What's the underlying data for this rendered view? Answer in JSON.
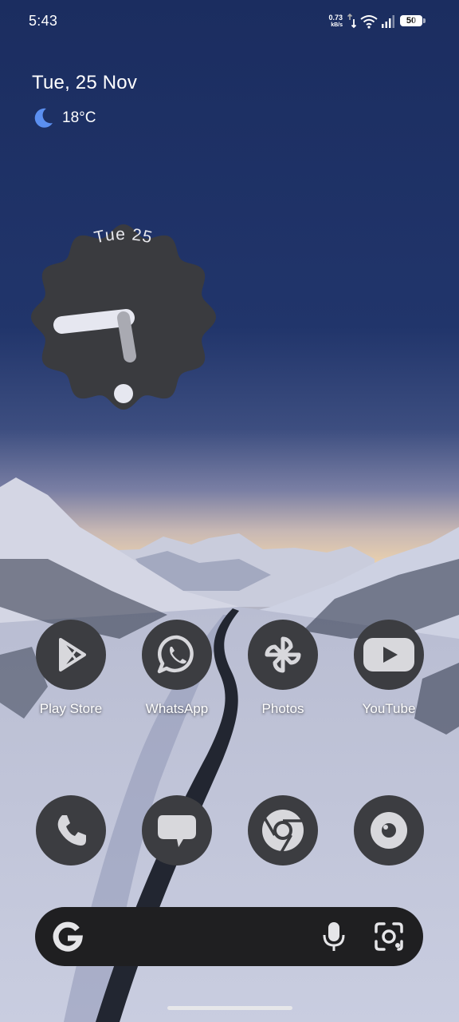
{
  "status_bar": {
    "time": "5:43",
    "net_speed": "0.73",
    "net_speed_unit": "kB/s",
    "battery": "50"
  },
  "at_a_glance": {
    "date": "Tue, 25 Nov",
    "weather_icon": "moon-icon",
    "temperature": "18°C"
  },
  "clock_widget": {
    "date_text": "Tue 25"
  },
  "apps_row_1": [
    {
      "label": "Play Store",
      "icon": "play-store-icon"
    },
    {
      "label": "WhatsApp",
      "icon": "whatsapp-icon"
    },
    {
      "label": "Photos",
      "icon": "photos-icon"
    },
    {
      "label": "YouTube",
      "icon": "youtube-icon"
    }
  ],
  "dock": [
    {
      "icon": "phone-icon"
    },
    {
      "icon": "messages-icon"
    },
    {
      "icon": "chrome-icon"
    },
    {
      "icon": "camera-icon"
    }
  ],
  "search_bar": {
    "logo": "google-g-icon",
    "mic": "mic-icon",
    "lens": "lens-icon"
  },
  "colors": {
    "icon_bg": "#3c3d41",
    "icon_glyph": "#d8d8dc",
    "search_bg": "#1f1f21",
    "sky_top": "#1b2c5e"
  }
}
